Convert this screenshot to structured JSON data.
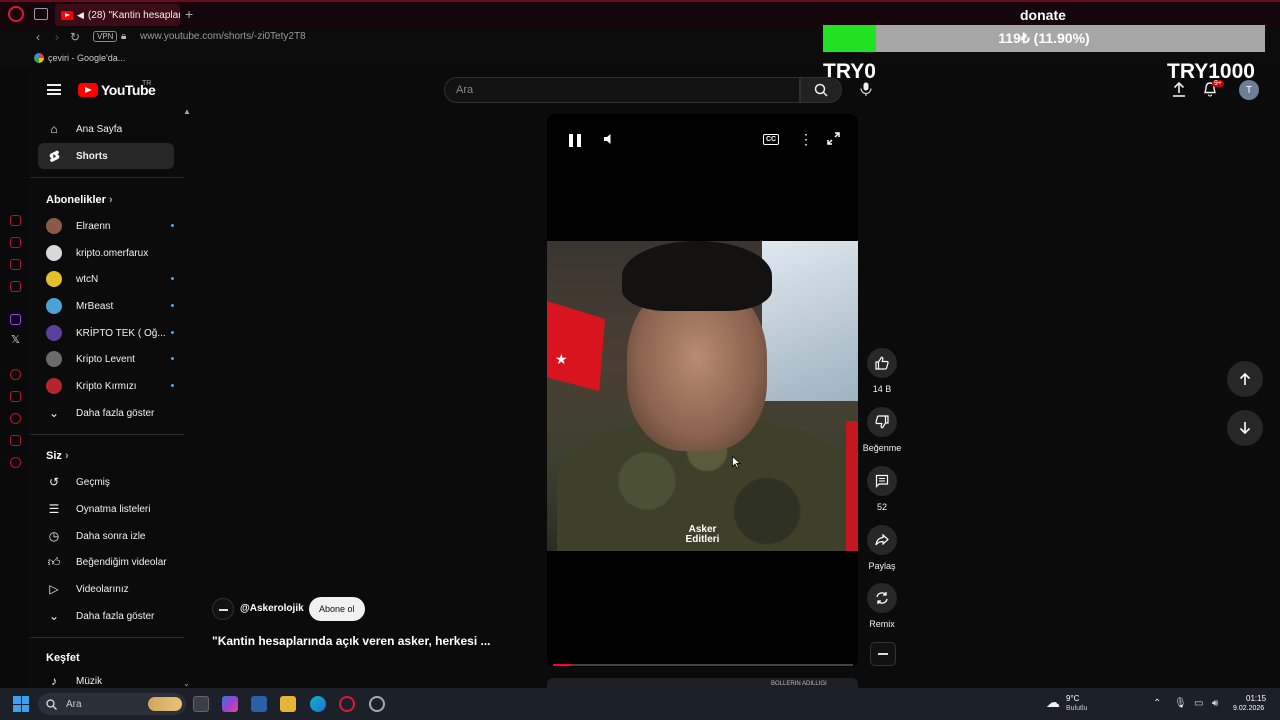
{
  "browser": {
    "tab_title": "(28) \"Kantin hesapların",
    "new_tab_symbol": "+",
    "vpn_label": "VPN",
    "url": "www.youtube.com/shorts/-zi0Tety2T8",
    "bookmark": "çeviri - Google'da..."
  },
  "donate": {
    "label": "donate",
    "progress_text": "119₺ (11.90%)",
    "progress_fraction": 0.119,
    "min_label": "TRY0",
    "max_label": "TRY1000",
    "fill_color": "#22e022",
    "track_color": "#a7a7a7"
  },
  "header": {
    "logo_text": "YouTube",
    "country_code": "TR",
    "search_placeholder": "Ara",
    "notification_badge": "9+",
    "avatar_letter": "T"
  },
  "sidebar": {
    "main": [
      {
        "label": "Ana Sayfa",
        "icon": "home-icon",
        "active": false
      },
      {
        "label": "Shorts",
        "icon": "shorts-icon",
        "active": true
      }
    ],
    "subscriptions_title": "Abonelikler",
    "subscriptions": [
      {
        "label": "Elraenn",
        "color": "#8a5a44"
      },
      {
        "label": "kripto.omerfarux",
        "color": "#d8d8d8"
      },
      {
        "label": "wtcN",
        "color": "#e3c02a"
      },
      {
        "label": "MrBeast",
        "color": "#4aa3d8"
      },
      {
        "label": "KRİPTO TEK ( Oğ...",
        "color": "#5b3f9e"
      },
      {
        "label": "Kripto Levent",
        "color": "#6a6a6a"
      },
      {
        "label": "Kripto Kırmızı",
        "color": "#b3262e"
      }
    ],
    "show_more": "Daha fazla göster",
    "you_title": "Siz",
    "you_items": [
      {
        "label": "Geçmiş",
        "icon": "history-icon"
      },
      {
        "label": "Oynatma listeleri",
        "icon": "playlist-icon"
      },
      {
        "label": "Daha sonra izle",
        "icon": "clock-icon"
      },
      {
        "label": "Beğendiğim videolar",
        "icon": "like-icon"
      },
      {
        "label": "Videolarınız",
        "icon": "video-icon"
      }
    ],
    "show_more_2": "Daha fazla göster",
    "explore_title": "Keşfet",
    "explore_items": [
      {
        "label": "Müzik",
        "icon": "music-icon"
      }
    ]
  },
  "short": {
    "watermark_line1": "Asker",
    "watermark_line2": "Editleri",
    "playback_fraction": 0.06,
    "channel": "@Askerolojik",
    "subscribe": "Abone ol",
    "title": "\"Kantin hesaplarında açık veren asker, herkesi ...",
    "next_peek_text": "BOLLERIN ADILLIGI"
  },
  "actions": {
    "likes": "14 B",
    "dislike": "Beğenme",
    "comments": "52",
    "share": "Paylaş",
    "remix": "Remix"
  },
  "taskbar": {
    "search": "Ara",
    "temperature": "9°C",
    "weather": "Bulutlu",
    "time": "01:15",
    "date": "9.02.2026"
  }
}
